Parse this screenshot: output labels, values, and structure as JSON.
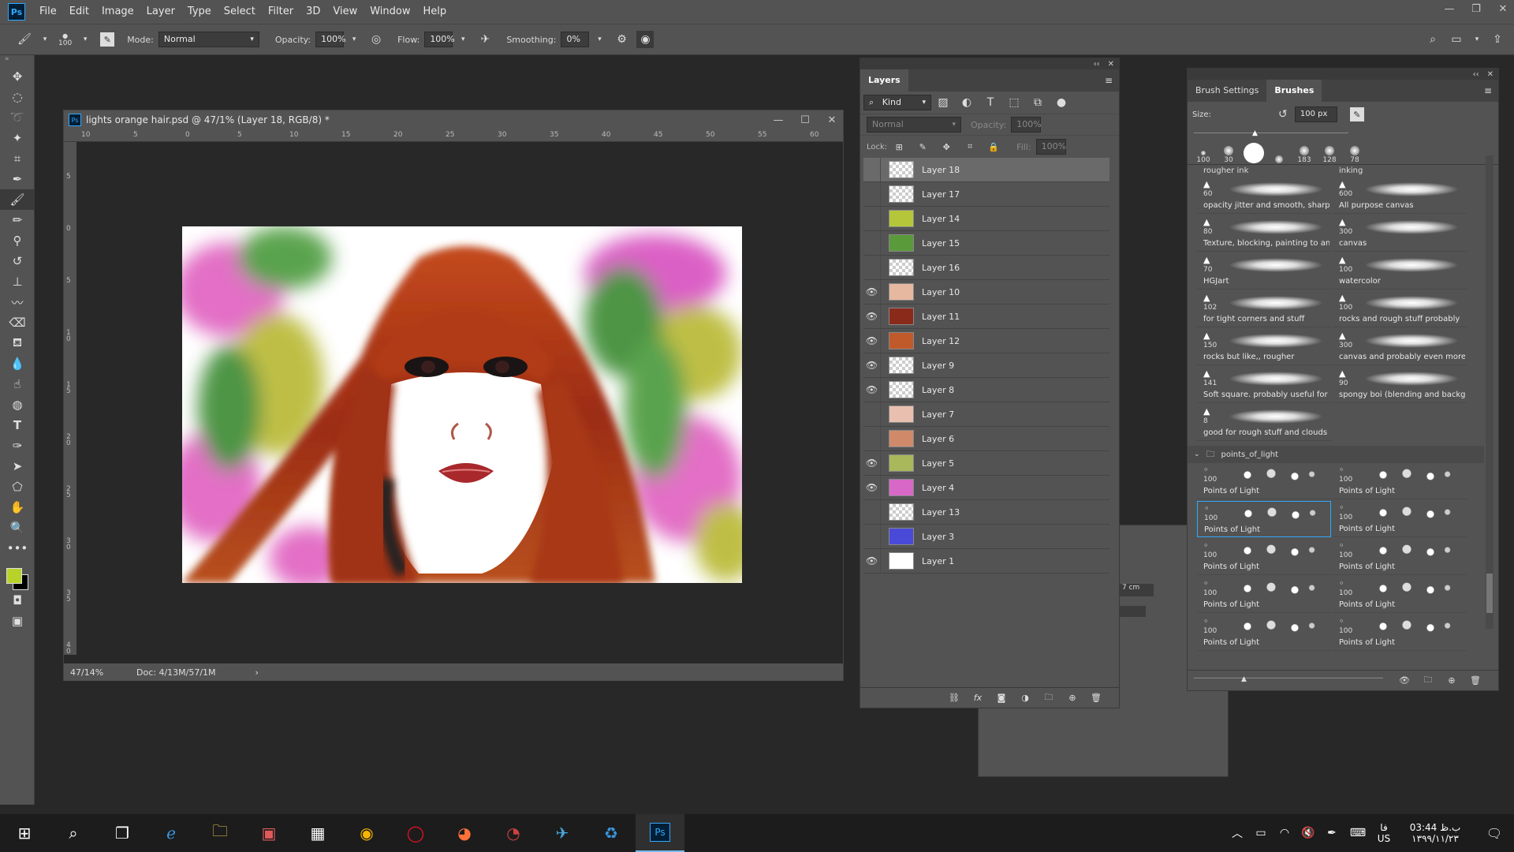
{
  "app": {
    "logo": "Ps",
    "menu": [
      "File",
      "Edit",
      "Image",
      "Layer",
      "Type",
      "Select",
      "Filter",
      "3D",
      "View",
      "Window",
      "Help"
    ]
  },
  "options": {
    "brush_size": "100",
    "mode_label": "Mode:",
    "mode_value": "Normal",
    "opacity_label": "Opacity:",
    "opacity_value": "100%",
    "flow_label": "Flow:",
    "flow_value": "100%",
    "smoothing_label": "Smoothing:",
    "smoothing_value": "0%"
  },
  "document": {
    "title": "lights orange hair.psd @ 47/1% (Layer 18, RGB/8) *",
    "zoom": "47/14%",
    "doc_info": "Doc: 4/13M/57/1M",
    "ruler_top": [
      "10",
      "5",
      "0",
      "5",
      "10",
      "15",
      "20",
      "25",
      "30",
      "35",
      "40",
      "45",
      "50",
      "55",
      "60"
    ],
    "ruler_left": [
      "5",
      "0",
      "5",
      "1 0",
      "1 5",
      "2 0",
      "2 5",
      "3 0",
      "3 5",
      "4 0"
    ]
  },
  "layers": {
    "tab": "Layers",
    "filter_kind": "Kind",
    "blend_mode": "Normal",
    "opacity_label": "Opacity:",
    "opacity_value": "100%",
    "lock_label": "Lock:",
    "fill_label": "Fill:",
    "fill_value": "100%",
    "items": [
      {
        "name": "Layer 18",
        "visible": false,
        "selected": true,
        "thumb": "transparent"
      },
      {
        "name": "Layer 17",
        "visible": false,
        "selected": false,
        "thumb": "transparent"
      },
      {
        "name": "Layer 14",
        "visible": false,
        "selected": false,
        "thumb": "#b5c63a"
      },
      {
        "name": "Layer 15",
        "visible": false,
        "selected": false,
        "thumb": "#5a9a3a"
      },
      {
        "name": "Layer 16",
        "visible": false,
        "selected": false,
        "thumb": "transparent"
      },
      {
        "name": "Layer 10",
        "visible": true,
        "selected": false,
        "thumb": "#e7b8a0"
      },
      {
        "name": "Layer 11",
        "visible": true,
        "selected": false,
        "thumb": "#8a2a1a"
      },
      {
        "name": "Layer 12",
        "visible": true,
        "selected": false,
        "thumb": "#c05a2a"
      },
      {
        "name": "Layer 9",
        "visible": true,
        "selected": false,
        "thumb": "transparent"
      },
      {
        "name": "Layer 8",
        "visible": true,
        "selected": false,
        "thumb": "transparent"
      },
      {
        "name": "Layer 7",
        "visible": false,
        "selected": false,
        "thumb": "#e9c0b0"
      },
      {
        "name": "Layer 6",
        "visible": false,
        "selected": false,
        "thumb": "#d08a6a"
      },
      {
        "name": "Layer 5",
        "visible": true,
        "selected": false,
        "thumb": "#a8b85a"
      },
      {
        "name": "Layer 4",
        "visible": true,
        "selected": false,
        "thumb": "#d868c8"
      },
      {
        "name": "Layer 13",
        "visible": false,
        "selected": false,
        "thumb": "transparent"
      },
      {
        "name": "Layer 3",
        "visible": false,
        "selected": false,
        "thumb": "#4a4ad8"
      },
      {
        "name": "Layer 1",
        "visible": true,
        "selected": false,
        "thumb": "#ffffff"
      }
    ]
  },
  "brushes": {
    "tab_settings": "Brush Settings",
    "tab_brushes": "Brushes",
    "size_label": "Size:",
    "size_value": "100 px",
    "recent": [
      "100",
      "30",
      "",
      "",
      "183",
      "128",
      "78"
    ],
    "top_left": "rougher ink",
    "top_right": "inking",
    "items": [
      {
        "size": "60",
        "name": "opacity jitter and smooth, sharp i..."
      },
      {
        "size": "600",
        "name": "All purpose canvas"
      },
      {
        "size": "80",
        "name": "Texture, blocking, painting to an..."
      },
      {
        "size": "300",
        "name": "canvas"
      },
      {
        "size": "70",
        "name": "HGJart"
      },
      {
        "size": "100",
        "name": "watercolor"
      },
      {
        "size": "102",
        "name": "for tight corners and stuff"
      },
      {
        "size": "100",
        "name": "rocks and rough stuff probably"
      },
      {
        "size": "150",
        "name": "rocks but like,, rougher"
      },
      {
        "size": "300",
        "name": "canvas and probably even more r..."
      },
      {
        "size": "141",
        "name": "Soft square. probably useful for c..."
      },
      {
        "size": "90",
        "name": "spongy boi (blending and backgr..."
      },
      {
        "size": "8",
        "name": "good for rough stuff and clouds"
      }
    ],
    "group_name": "points_of_light",
    "group_items": [
      {
        "size": "100",
        "name": "Points of Light"
      },
      {
        "size": "100",
        "name": "Points of Light"
      },
      {
        "size": "100",
        "name": "Points of Light"
      },
      {
        "size": "100",
        "name": "Points of Light"
      },
      {
        "size": "100",
        "name": "Points of Light"
      },
      {
        "size": "100",
        "name": "Points of Light"
      },
      {
        "size": "100",
        "name": "Points of Light"
      },
      {
        "size": "100",
        "name": "Points of Light"
      },
      {
        "size": "100",
        "name": "Points of Light"
      },
      {
        "size": "100",
        "name": "Points of Light"
      }
    ]
  },
  "hidden_panel": {
    "field_value": "7 cm"
  },
  "taskbar": {
    "time": "03:44 ب.ظ",
    "date": "۱۳۹۹/۱۱/۲۳",
    "lang_top": "فا",
    "lang_bottom": "US"
  }
}
